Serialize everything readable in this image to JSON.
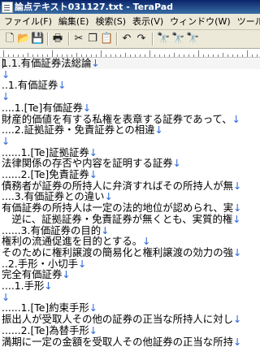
{
  "window": {
    "title": "論点テキスト031127.txt - TeraPad"
  },
  "menu": [
    "ファイル(F)",
    "編集(E)",
    "検索(S)",
    "表示(V)",
    "ウィンドウ(W)",
    "ツール(T)"
  ],
  "toolbar_icons": [
    "new-file-icon",
    "open-folder-icon",
    "save-icon",
    "print-icon",
    "cut-icon",
    "copy-icon",
    "paste-icon",
    "undo-icon",
    "redo-icon",
    "find-icon",
    "find-next-icon",
    "find-prev-icon"
  ],
  "editor": {
    "return_mark": "↓",
    "lines": [
      "1.1.有価証券法総論",
      "",
      "..1.有価証券",
      "",
      "....1.[Te]有価証券",
      "財産的価値を有する私権を表章する証券であって、",
      "....2.証拠証券・免責証券との相違",
      "",
      "......1.[Te]証拠証券",
      "法律関係の存否や内容を証明する証券",
      "......2.[Te]免責証券",
      "債務者が証券の所持人に弁済すればその所持人が無",
      "....3.有価証券との違い",
      "有価証券の所持人は一定の法的地位が認められ、実",
      "　逆に、証拠証券・免責証券が無くとも、実質的権",
      "......3.有価証券の目的",
      "権利の流通促進を目的とする。",
      "そのために権利譲渡の簡易化と権利譲渡の効力の強",
      "..2.手形・小切手",
      "完全有価証券",
      "....1.手形",
      "",
      "......1.[Te]約束手形",
      "振出人が受取人その他の証券の正当な所持人に対し",
      "......2.[Te]為替手形",
      "満期に一定の金額を受取人その他証券の正当な所持"
    ]
  }
}
